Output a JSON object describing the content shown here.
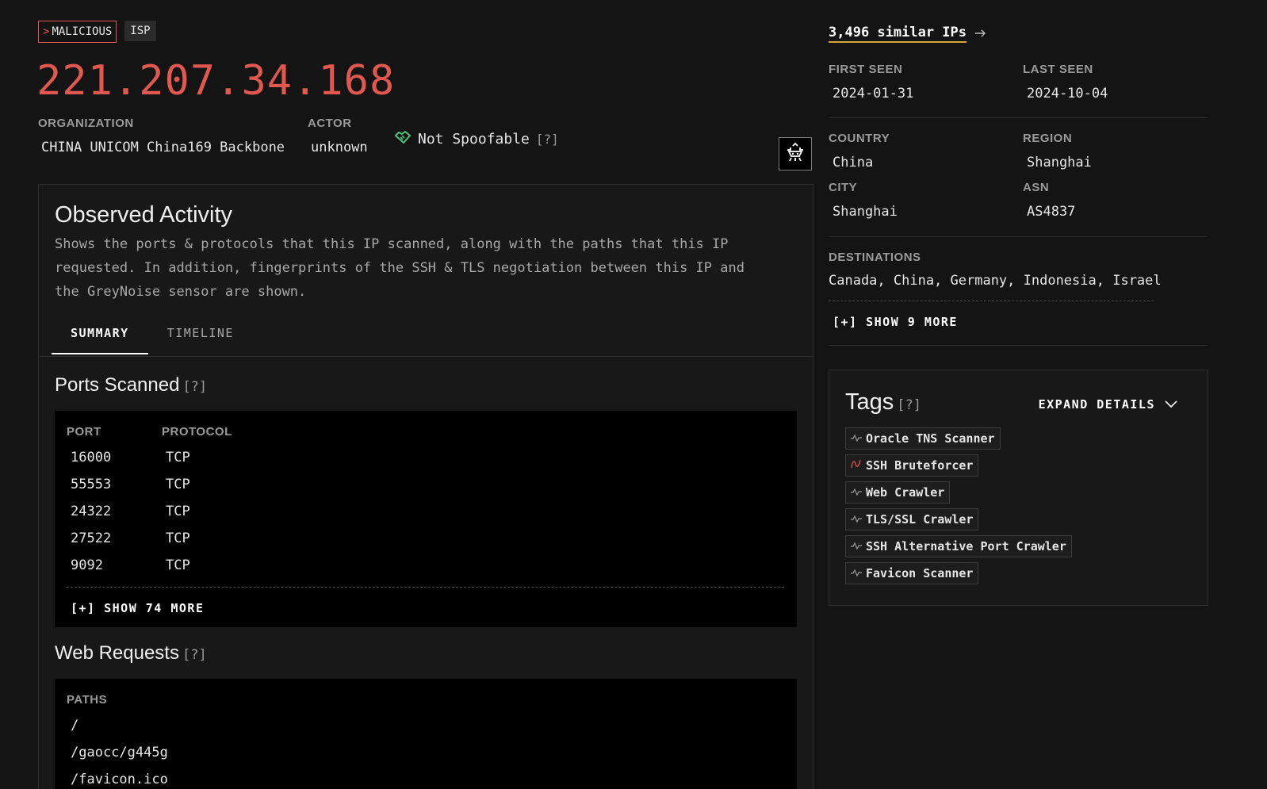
{
  "header": {
    "badge_malicious_prefix": ">",
    "badge_malicious": "MALICIOUS",
    "badge_isp": "ISP",
    "ip": "221.207.34.168",
    "organization_label": "ORGANIZATION",
    "organization_value": "CHINA UNICOM China169 Backbone",
    "actor_label": "ACTOR",
    "actor_value": "unknown",
    "spoofable_text": "Not Spoofable",
    "help_text": "[?]"
  },
  "observed": {
    "title": "Observed Activity",
    "description": "Shows the ports & protocols that this IP scanned, along with the paths that this IP requested. In addition, fingerprints of the SSH & TLS negotiation between this IP and the GreyNoise sensor are shown.",
    "tabs": [
      {
        "label": "SUMMARY",
        "active": true
      },
      {
        "label": "TIMELINE",
        "active": false
      }
    ],
    "ports_title": "Ports Scanned",
    "ports_headers": {
      "port": "PORT",
      "protocol": "PROTOCOL"
    },
    "ports": [
      {
        "port": "16000",
        "protocol": "TCP"
      },
      {
        "port": "55553",
        "protocol": "TCP"
      },
      {
        "port": "24322",
        "protocol": "TCP"
      },
      {
        "port": "27522",
        "protocol": "TCP"
      },
      {
        "port": "9092",
        "protocol": "TCP"
      }
    ],
    "ports_show_more": "[+] SHOW 74 MORE",
    "web_title": "Web Requests",
    "paths_header": "PATHS",
    "paths": [
      "/",
      "/gaocc/g445g",
      "/favicon.ico"
    ]
  },
  "sidebar": {
    "similar_ips": "3,496 similar IPs",
    "first_seen_label": "FIRST SEEN",
    "first_seen_value": "2024-01-31",
    "last_seen_label": "LAST SEEN",
    "last_seen_value": "2024-10-04",
    "country_label": "COUNTRY",
    "country_value": "China",
    "region_label": "REGION",
    "region_value": "Shanghai",
    "city_label": "CITY",
    "city_value": "Shanghai",
    "asn_label": "ASN",
    "asn_value": "AS4837",
    "destinations_label": "DESTINATIONS",
    "destinations_value": "Canada, China, Germany, Indonesia, Israel",
    "destinations_show_more": "[+] SHOW 9 MORE"
  },
  "tags": {
    "title": "Tags",
    "expand_label": "EXPAND DETAILS",
    "items": [
      {
        "label": "Oracle TNS Scanner",
        "icon": "activity-icon",
        "color": "#9a9a9a"
      },
      {
        "label": "SSH Bruteforcer",
        "icon": "malicious-wave-icon",
        "color": "#e0584f"
      },
      {
        "label": "Web Crawler",
        "icon": "activity-icon",
        "color": "#9a9a9a"
      },
      {
        "label": "TLS/SSL Crawler",
        "icon": "activity-icon",
        "color": "#9a9a9a"
      },
      {
        "label": "SSH Alternative Port Crawler",
        "icon": "activity-icon",
        "color": "#9a9a9a"
      },
      {
        "label": "Favicon Scanner",
        "icon": "activity-icon",
        "color": "#9a9a9a"
      }
    ]
  },
  "colors": {
    "malicious": "#e0584f",
    "accent_underline": "#d4a73a",
    "not_spoofable": "#4ec27a",
    "background": "#141414"
  }
}
